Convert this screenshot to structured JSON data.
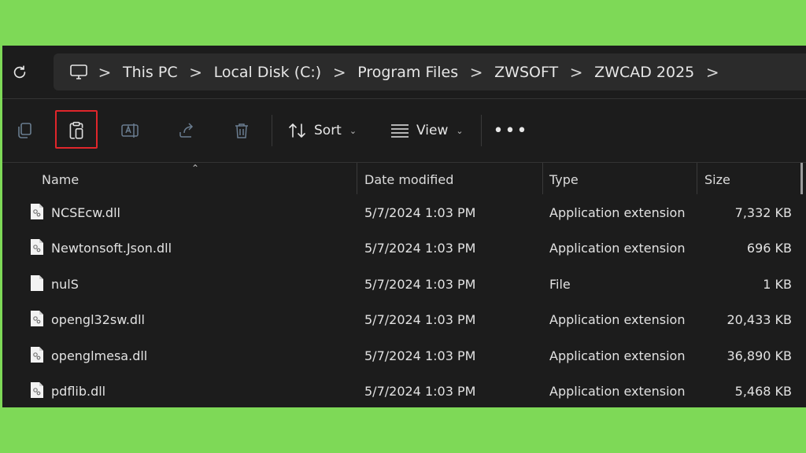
{
  "breadcrumb": {
    "items": [
      "This PC",
      "Local Disk (C:)",
      "Program Files",
      "ZWSOFT",
      "ZWCAD 2025"
    ],
    "separator": ">"
  },
  "toolbar": {
    "sort_label": "Sort",
    "view_label": "View",
    "more_label": "•••",
    "highlight_color": "#e0262b"
  },
  "columns": {
    "name": "Name",
    "date": "Date modified",
    "type": "Type",
    "size": "Size"
  },
  "files": [
    {
      "name": "NCSEcw.dll",
      "date": "5/7/2024 1:03 PM",
      "type": "Application extension",
      "size": "7,332 KB",
      "icon": "dll-file-icon"
    },
    {
      "name": "Newtonsoft.Json.dll",
      "date": "5/7/2024 1:03 PM",
      "type": "Application extension",
      "size": "696 KB",
      "icon": "dll-file-icon"
    },
    {
      "name": "nulS",
      "date": "5/7/2024 1:03 PM",
      "type": "File",
      "size": "1 KB",
      "icon": "file-icon"
    },
    {
      "name": "opengl32sw.dll",
      "date": "5/7/2024 1:03 PM",
      "type": "Application extension",
      "size": "20,433 KB",
      "icon": "dll-file-icon"
    },
    {
      "name": "openglmesa.dll",
      "date": "5/7/2024 1:03 PM",
      "type": "Application extension",
      "size": "36,890 KB",
      "icon": "dll-file-icon"
    },
    {
      "name": "pdflib.dll",
      "date": "5/7/2024 1:03 PM",
      "type": "Application extension",
      "size": "5,468 KB",
      "icon": "dll-file-icon"
    }
  ],
  "colors": {
    "background": "#7ed957",
    "window": "#1c1c1c",
    "address_box": "#2b2b2b"
  }
}
